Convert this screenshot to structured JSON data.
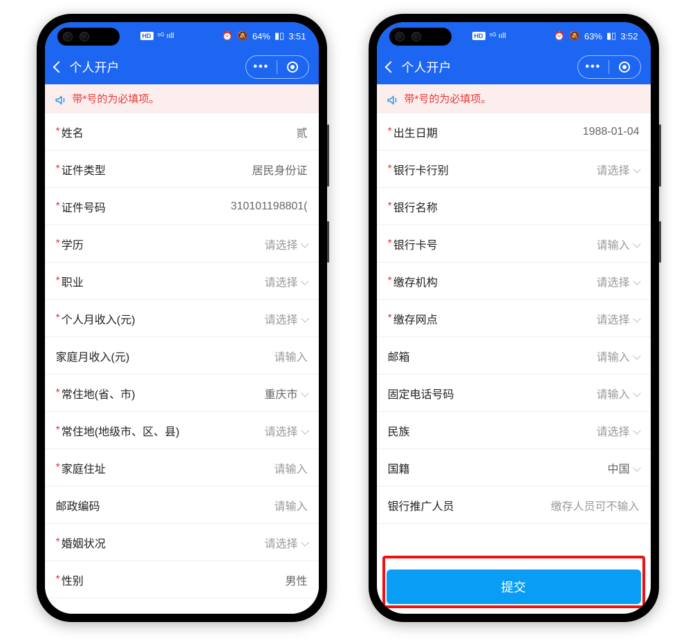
{
  "phones": [
    {
      "status": {
        "battery": "64%",
        "time": "3:51"
      },
      "title": "个人开户",
      "notice": "带*号的为必填项。",
      "rows": [
        {
          "required": true,
          "label": "姓名",
          "value": "贰",
          "has_data": true,
          "chev": false
        },
        {
          "required": true,
          "label": "证件类型",
          "value": "居民身份证",
          "has_data": true,
          "chev": false
        },
        {
          "required": true,
          "label": "证件号码",
          "value": "310101198801(",
          "has_data": true,
          "chev": false
        },
        {
          "required": true,
          "label": "学历",
          "value": "请选择",
          "has_data": false,
          "chev": true
        },
        {
          "required": true,
          "label": "职业",
          "value": "请选择",
          "has_data": false,
          "chev": true
        },
        {
          "required": true,
          "label": "个人月收入(元)",
          "value": "请选择",
          "has_data": false,
          "chev": true
        },
        {
          "required": false,
          "label": "家庭月收入(元)",
          "value": "请输入",
          "has_data": false,
          "chev": false
        },
        {
          "required": true,
          "label": "常住地(省、市)",
          "value": "重庆市",
          "has_data": true,
          "chev": true
        },
        {
          "required": true,
          "label": "常住地(地级市、区、县)",
          "value": "请选择",
          "has_data": false,
          "chev": true
        },
        {
          "required": true,
          "label": "家庭住址",
          "value": "请输入",
          "has_data": false,
          "chev": false
        },
        {
          "required": false,
          "label": "邮政编码",
          "value": "请输入",
          "has_data": false,
          "chev": false
        },
        {
          "required": true,
          "label": "婚姻状况",
          "value": "请选择",
          "has_data": false,
          "chev": true
        },
        {
          "required": true,
          "label": "性别",
          "value": "男性",
          "has_data": true,
          "chev": false
        }
      ],
      "submit": null
    },
    {
      "status": {
        "battery": "63%",
        "time": "3:52"
      },
      "title": "个人开户",
      "notice": "带*号的为必填项。",
      "rows": [
        {
          "required": true,
          "label": "出生日期",
          "value": "1988-01-04",
          "has_data": true,
          "chev": false
        },
        {
          "required": true,
          "label": "银行卡行别",
          "value": "请选择",
          "has_data": false,
          "chev": true
        },
        {
          "required": true,
          "label": "银行名称",
          "value": "",
          "has_data": false,
          "chev": false
        },
        {
          "required": true,
          "label": "银行卡号",
          "value": "请输入",
          "has_data": false,
          "chev": true
        },
        {
          "required": true,
          "label": "缴存机构",
          "value": "请选择",
          "has_data": false,
          "chev": true
        },
        {
          "required": true,
          "label": "缴存网点",
          "value": "请选择",
          "has_data": false,
          "chev": true
        },
        {
          "required": false,
          "label": "邮箱",
          "value": "请输入",
          "has_data": false,
          "chev": true
        },
        {
          "required": false,
          "label": "固定电话号码",
          "value": "请输入",
          "has_data": false,
          "chev": true
        },
        {
          "required": false,
          "label": "民族",
          "value": "请选择",
          "has_data": false,
          "chev": true
        },
        {
          "required": false,
          "label": "国籍",
          "value": "中国",
          "has_data": true,
          "chev": true
        },
        {
          "required": false,
          "label": "银行推广人员",
          "value": "缴存人员可不输入",
          "has_data": false,
          "chev": false
        }
      ],
      "submit": "提交"
    }
  ],
  "icons": {
    "hd": "HD",
    "fiveg": "5G",
    "signal": "๛ıll"
  }
}
